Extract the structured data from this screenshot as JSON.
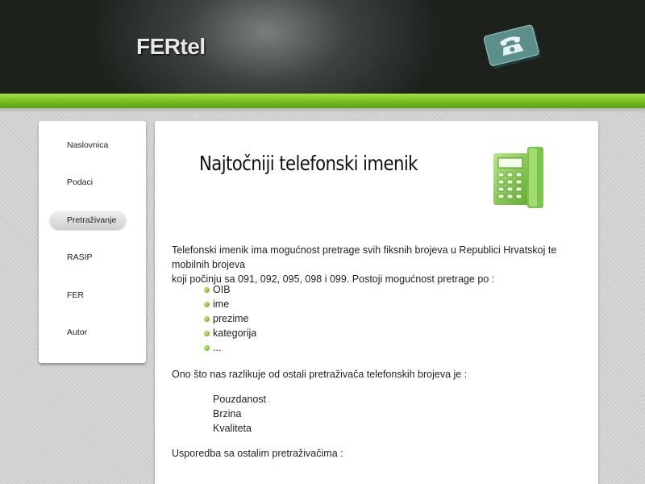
{
  "header": {
    "logo": "FERtel",
    "icon": "telephone-icon"
  },
  "sidebar": {
    "items": [
      {
        "label": "Naslovnica"
      },
      {
        "label": "Podaci"
      },
      {
        "label": "Pretraživanje",
        "active": true
      },
      {
        "label": "RASIP"
      },
      {
        "label": "FER"
      },
      {
        "label": "Autor"
      }
    ]
  },
  "main": {
    "title": "Najtočniji telefonski imenik",
    "icon": "desk-phone-icon",
    "intro_line1": "Telefonski imenik ima mogućnost pretrage svih fiksnih brojeva u Republici Hrvatskoj te mobilnih brojeva",
    "intro_line2": "koji počinju sa 091, 092, 095, 098 i 099. Postoji mogućnost pretrage po :",
    "search_options": [
      "OIB",
      "ime",
      "prezime",
      "kategorija",
      "..."
    ],
    "difference_text": "Ono što nas razlikuje od ostali pretraživača telefonskih brojeva je :",
    "advantages": [
      "Pouzdanost",
      "Brzina",
      "Kvaliteta"
    ],
    "comparison_text": "Usporedba sa ostalim pretraživačima :"
  },
  "colors": {
    "accent_green": "#7cc322",
    "header_dark": "#1c211c"
  }
}
